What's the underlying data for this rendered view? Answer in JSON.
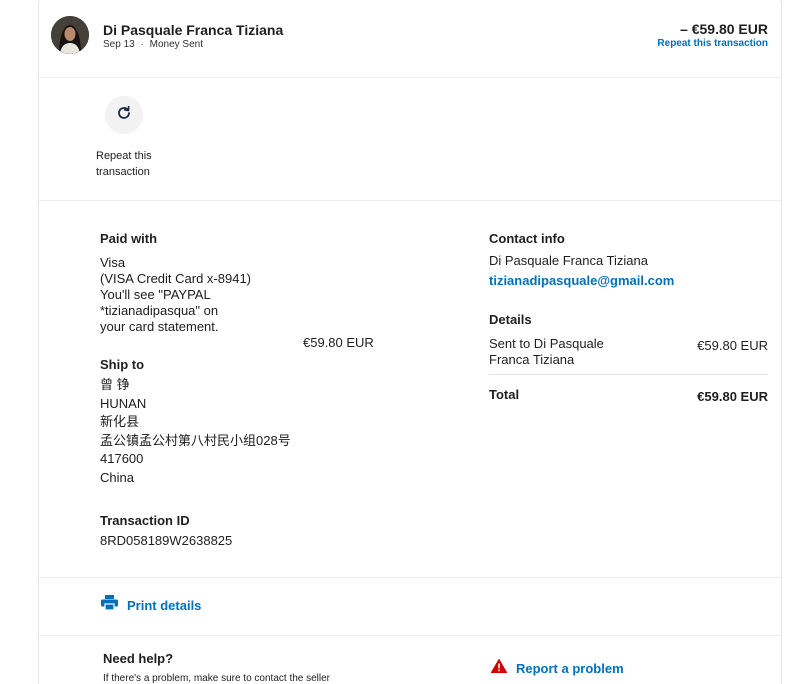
{
  "header": {
    "name": "Di Pasquale Franca Tiziana",
    "date": "Sep 13",
    "separator": "·",
    "type": "Money Sent",
    "amount": "– €59.80 EUR",
    "repeat_link": "Repeat this transaction"
  },
  "repeat_action": {
    "icon": "refresh-icon",
    "label": "Repeat this transaction"
  },
  "paid_with": {
    "heading": "Paid with",
    "lines": [
      "Visa",
      "(VISA Credit Card x-8941)",
      "You'll see \"PAYPAL",
      "*tizianadipasqua\" on",
      "your card statement."
    ],
    "amount": "€59.80 EUR"
  },
  "ship_to": {
    "heading": "Ship to",
    "lines": [
      "曾 铮",
      "HUNAN",
      "新化县",
      "孟公镇孟公村第八村民小组028号",
      "417600",
      "China"
    ]
  },
  "transaction": {
    "heading": "Transaction ID",
    "id": "8RD058189W2638825"
  },
  "contact": {
    "heading": "Contact info",
    "name": "Di Pasquale Franca Tiziana",
    "email": "tizianadipasquale@gmail.com"
  },
  "details": {
    "heading": "Details",
    "item_line1": "Sent to Di Pasquale",
    "item_line2": "Franca Tiziana",
    "item_amount": "€59.80 EUR",
    "total_label": "Total",
    "total_amount": "€59.80 EUR"
  },
  "print": {
    "icon": "printer-icon",
    "label": "Print details"
  },
  "help": {
    "heading": "Need help?",
    "text": "If there's a problem, make sure to contact the seller"
  },
  "report": {
    "icon": "warning-icon",
    "label": "Report a problem"
  },
  "colors": {
    "link": "#0070ba",
    "warning": "#d20000",
    "text": "#1f1f1f"
  }
}
